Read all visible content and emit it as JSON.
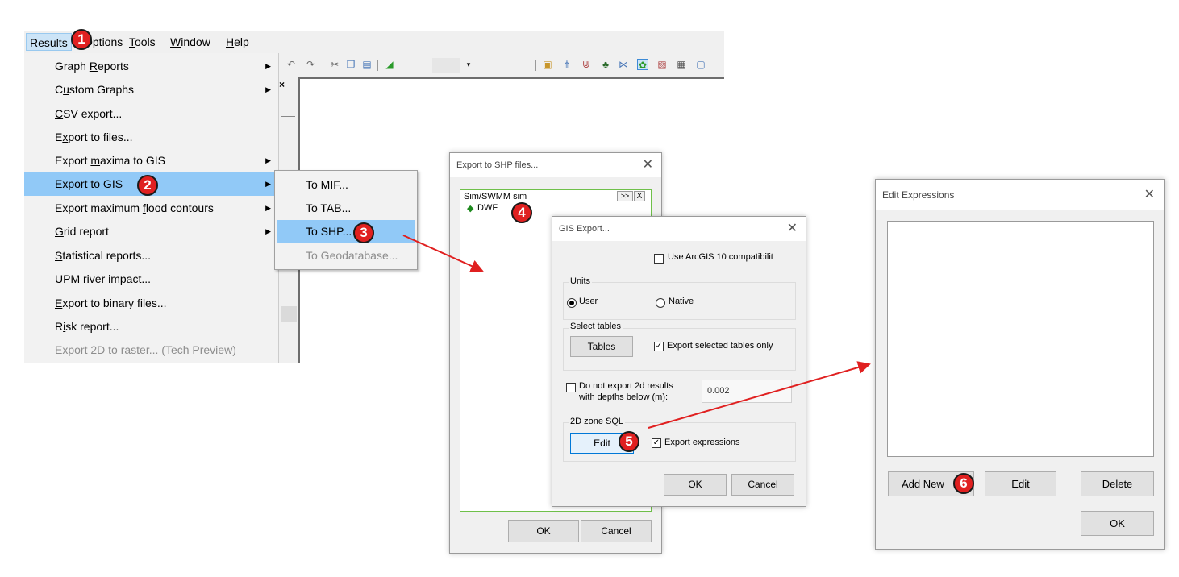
{
  "menubar": {
    "items": [
      "Results",
      "Options",
      "Tools",
      "Window",
      "Help"
    ]
  },
  "results_menu": {
    "items": [
      {
        "label": "Graph Reports",
        "submenu": true,
        "disabled": false
      },
      {
        "label": "Custom Graphs",
        "submenu": true,
        "disabled": false
      },
      {
        "label": "CSV export...",
        "submenu": false,
        "disabled": false
      },
      {
        "label": "Export to files...",
        "submenu": false,
        "disabled": false
      },
      {
        "label": "Export maxima to GIS",
        "submenu": true,
        "disabled": false
      },
      {
        "label": "Export to GIS",
        "submenu": true,
        "disabled": false
      },
      {
        "label": "Export maximum flood contours",
        "submenu": true,
        "disabled": false
      },
      {
        "label": "Grid report",
        "submenu": true,
        "disabled": false
      },
      {
        "label": "Statistical reports...",
        "submenu": false,
        "disabled": false
      },
      {
        "label": "UPM river impact...",
        "submenu": false,
        "disabled": false
      },
      {
        "label": "Export to binary files...",
        "submenu": false,
        "disabled": false
      },
      {
        "label": "Risk report...",
        "submenu": false,
        "disabled": false
      },
      {
        "label": "Export 2D to raster... (Tech Preview)",
        "submenu": false,
        "disabled": true
      }
    ]
  },
  "gis_submenu": {
    "items": [
      {
        "label": "To MIF...",
        "disabled": false
      },
      {
        "label": "To TAB...",
        "disabled": false
      },
      {
        "label": "To SHP...",
        "disabled": false
      },
      {
        "label": "To Geodatabase...",
        "disabled": true
      }
    ]
  },
  "markers": [
    "1",
    "2",
    "3",
    "4",
    "5",
    "6"
  ],
  "shp_dialog": {
    "title": "Export to SHP files...",
    "list_header": "Sim/SWMM sim",
    "list_expand": ">>",
    "list_close": "X",
    "list_item": "DWF",
    "ok": "OK",
    "cancel": "Cancel"
  },
  "gis_dialog": {
    "title": "GIS Export...",
    "arcgis_label": "Use ArcGIS 10 compatibilit",
    "units_group": "Units",
    "radio_user": "User",
    "radio_native": "Native",
    "tables_group": "Select tables",
    "tables_button": "Tables",
    "export_selected_label": "Export selected tables only",
    "no_export_label_line1": "Do not export 2d results",
    "no_export_label_line2": "with depths below (m):",
    "depth_value": "0.002",
    "zone_group": "2D zone SQL",
    "edit_button": "Edit",
    "export_expressions_label": "Export expressions",
    "ok": "OK",
    "cancel": "Cancel"
  },
  "expr_dialog": {
    "title": "Edit Expressions",
    "add_new": "Add New",
    "edit": "Edit",
    "delete": "Delete",
    "ok": "OK"
  },
  "colors": {
    "highlight": "#91c9f7",
    "marker": "#e02020",
    "arrow": "#e02020"
  }
}
